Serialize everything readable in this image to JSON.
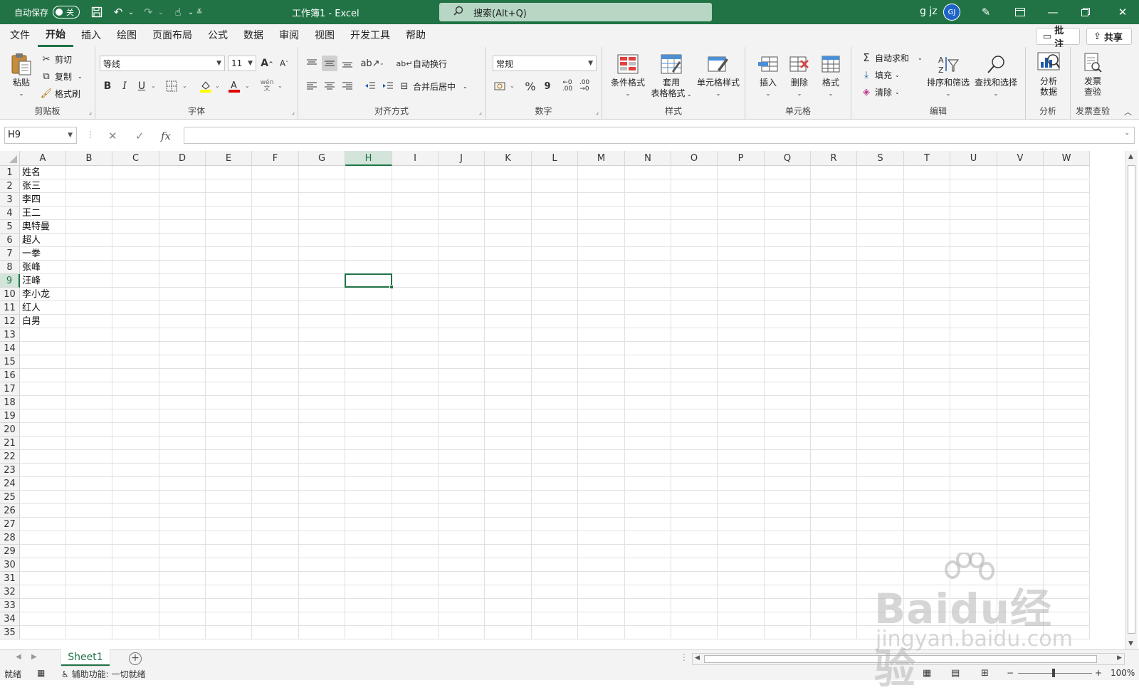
{
  "titlebar": {
    "autosave_label": "自动保存",
    "autosave_state": "关",
    "doc_title": "工作簿1 - Excel",
    "search_placeholder": "搜索(Alt+Q)",
    "user_name": "g jz",
    "avatar_initials": "GJ"
  },
  "menu": {
    "tabs": [
      "文件",
      "开始",
      "插入",
      "绘图",
      "页面布局",
      "公式",
      "数据",
      "审阅",
      "视图",
      "开发工具",
      "帮助"
    ],
    "active": "开始",
    "comments_label": "批注",
    "share_label": "共享"
  },
  "ribbon": {
    "clipboard": {
      "paste": "粘贴",
      "cut": "剪切",
      "copy": "复制",
      "format_painter": "格式刷",
      "label": "剪贴板"
    },
    "font": {
      "font_name": "等线",
      "font_size": "11",
      "label": "字体",
      "bold": "B",
      "italic": "I",
      "underline": "U",
      "phonetic": "wén",
      "grow": "A",
      "shrink": "A"
    },
    "alignment": {
      "wrap_text": "自动换行",
      "merge_center": "合并后居中",
      "label": "对齐方式"
    },
    "number": {
      "format": "常规",
      "label": "数字",
      "percent": "%",
      "comma": "9",
      "inc_decimal": ".00",
      "dec_decimal": ".00"
    },
    "styles": {
      "conditional": "条件格式",
      "table_format_1": "套用",
      "table_format_2": "表格格式",
      "cell_styles": "单元格样式",
      "label": "样式"
    },
    "cells": {
      "insert": "插入",
      "delete": "删除",
      "format": "格式",
      "label": "单元格"
    },
    "editing": {
      "autosum": "自动求和",
      "fill": "填充",
      "clear": "清除",
      "sort_filter": "排序和筛选",
      "find_select": "查找和选择",
      "label": "编辑"
    },
    "analysis": {
      "analyze_1": "分析",
      "analyze_2": "数据",
      "label": "分析"
    },
    "invoice": {
      "check_1": "发票",
      "check_2": "查验",
      "label": "发票查验"
    }
  },
  "formula_bar": {
    "name_box": "H9",
    "formula": ""
  },
  "grid": {
    "columns": [
      "A",
      "B",
      "C",
      "D",
      "E",
      "F",
      "G",
      "H",
      "I",
      "J",
      "K",
      "L",
      "M",
      "N",
      "O",
      "P",
      "Q",
      "R",
      "S",
      "T",
      "U",
      "V",
      "W"
    ],
    "rows_visible": 35,
    "selected_col": "H",
    "selected_row": 9,
    "column_a_values": [
      "姓名",
      "张三",
      "李四",
      "王二",
      "奥特曼",
      "超人",
      "一拳",
      "张峰",
      "汪峰",
      "李小龙",
      "红人",
      "白男"
    ]
  },
  "sheets": {
    "tabs": [
      "Sheet1"
    ],
    "active": "Sheet1"
  },
  "status": {
    "ready": "就绪",
    "accessibility": "辅助功能: 一切就绪",
    "zoom": "100%"
  },
  "watermark": {
    "main": "Baidu经验",
    "sub": "jingyan.baidu.com"
  },
  "colors": {
    "brand": "#217346",
    "search_bg": "#b7d7c4",
    "ribbon_bg": "#f3f3f3"
  }
}
